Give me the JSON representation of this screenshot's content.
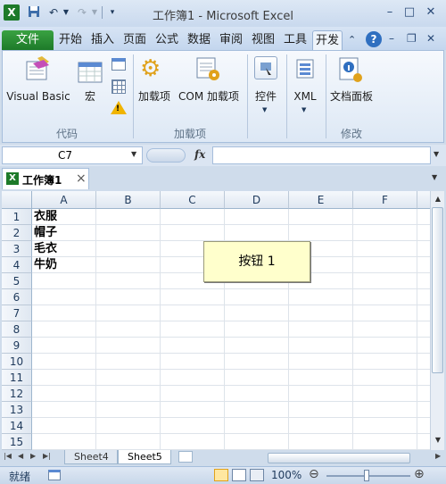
{
  "window": {
    "title": "工作簿1 - Microsoft Excel"
  },
  "ribbon_tabs": [
    "文件",
    "开始",
    "插入",
    "页面",
    "公式",
    "数据",
    "审阅",
    "视图",
    "工具",
    "开发"
  ],
  "ribbon": {
    "groups": [
      {
        "name": "代码",
        "items": [
          "Visual Basic",
          "宏"
        ]
      },
      {
        "name": "加载项",
        "items": [
          "加载项",
          "COM 加载项"
        ]
      },
      {
        "name": "",
        "items": [
          "控件",
          "XML"
        ]
      },
      {
        "name": "修改",
        "items": [
          "文档面板"
        ]
      }
    ]
  },
  "formula_bar": {
    "name_box": "C7",
    "fx": "fx",
    "value": ""
  },
  "workbook_tab": {
    "label": "工作簿1",
    "close": "×"
  },
  "grid": {
    "columns": [
      "A",
      "B",
      "C",
      "D",
      "E",
      "F"
    ],
    "rows": [
      "1",
      "2",
      "3",
      "4",
      "5",
      "6",
      "7",
      "8",
      "9",
      "10",
      "11",
      "12",
      "13",
      "14",
      "15"
    ],
    "cells_A": [
      "衣服",
      "帽子",
      "毛衣",
      "牛奶"
    ],
    "button_label": "按钮 1"
  },
  "sheets": [
    "Sheet4",
    "Sheet5"
  ],
  "status": {
    "ready": "就绪",
    "zoom": "100%"
  }
}
